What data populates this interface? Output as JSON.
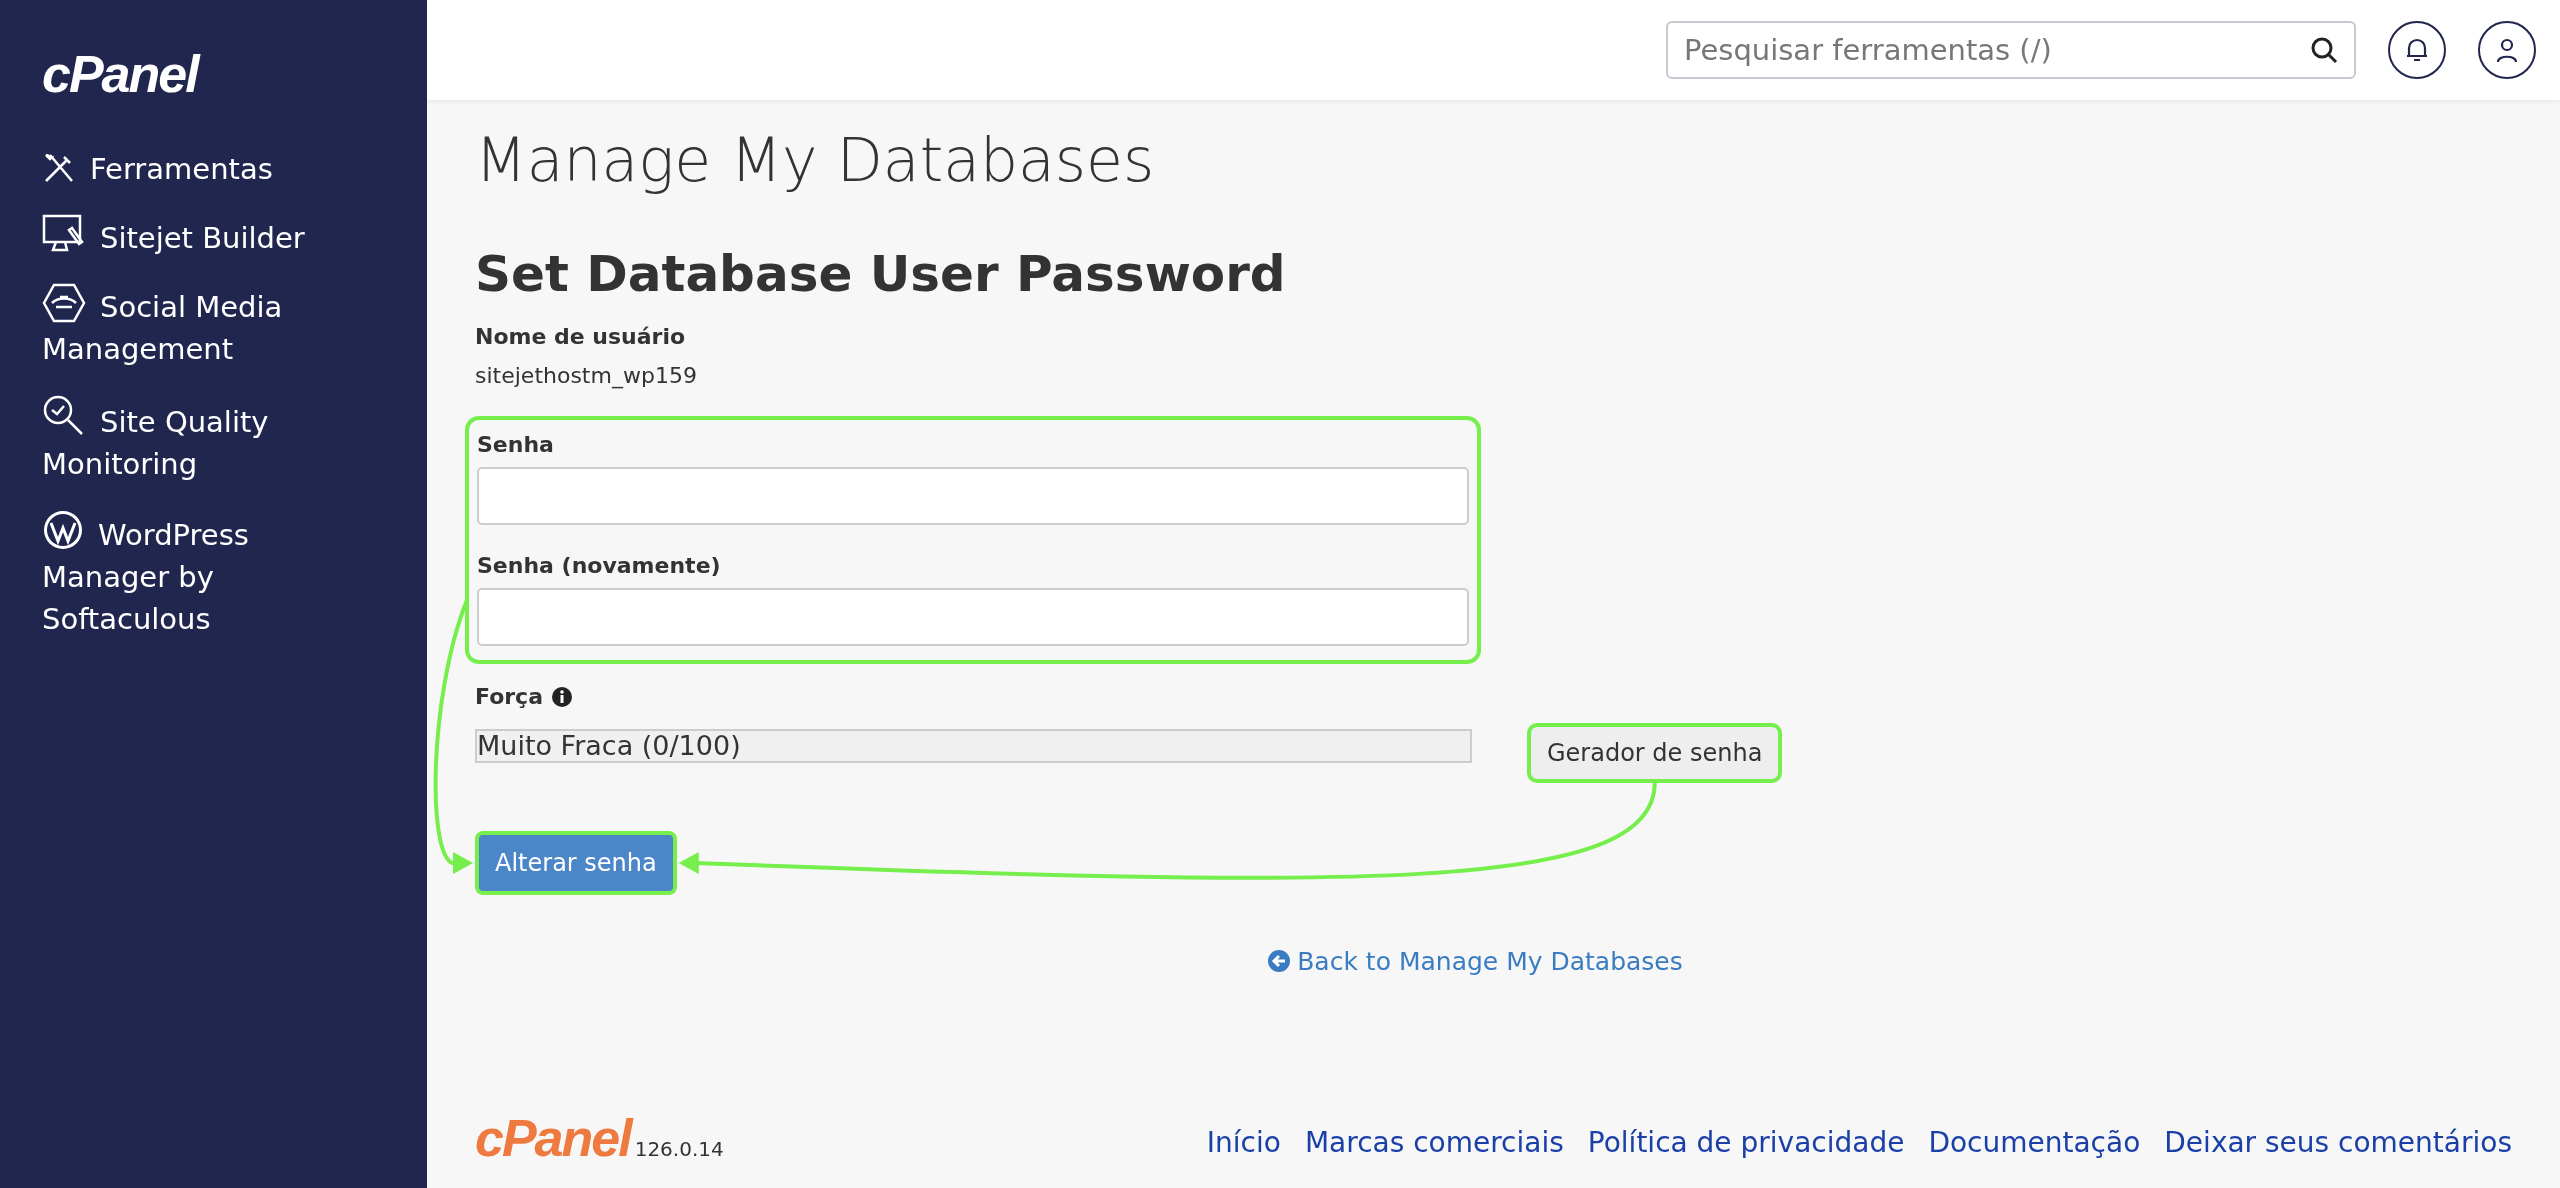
{
  "sidebar": {
    "logo": "cPanel",
    "items": [
      {
        "label": "Ferramentas"
      },
      {
        "label": "Sitejet Builder"
      },
      {
        "label": "Social Media Management"
      },
      {
        "label": "Site Quality Monitoring"
      },
      {
        "label": "WordPress Manager by Softaculous"
      }
    ]
  },
  "header": {
    "search": {
      "placeholder": "Pesquisar ferramentas (/)"
    }
  },
  "page_title": "Manage My Databases",
  "section_title": "Set Database User Password",
  "username": {
    "label": "Nome de usuário",
    "value": "sitejethostm_wp159"
  },
  "password_fields": {
    "highlighted": true,
    "fields": [
      {
        "label": "Senha"
      },
      {
        "label": "Senha (novamente)"
      }
    ]
  },
  "strength": {
    "label": "Força",
    "meter_text": "Muito Fraca (0/100)",
    "level": 0
  },
  "generator_button": {
    "label": "Gerador de senha",
    "highlighted": true
  },
  "submit_button": {
    "label": "Alterar senha",
    "highlighted": true
  },
  "back_link": "Back to Manage My Databases",
  "footer": {
    "logo": "cPanel",
    "version": "126.0.14",
    "links": [
      "Início",
      "Marcas comerciais",
      "Política de privacidade",
      "Documentação",
      "Deixar seus comentários"
    ]
  }
}
